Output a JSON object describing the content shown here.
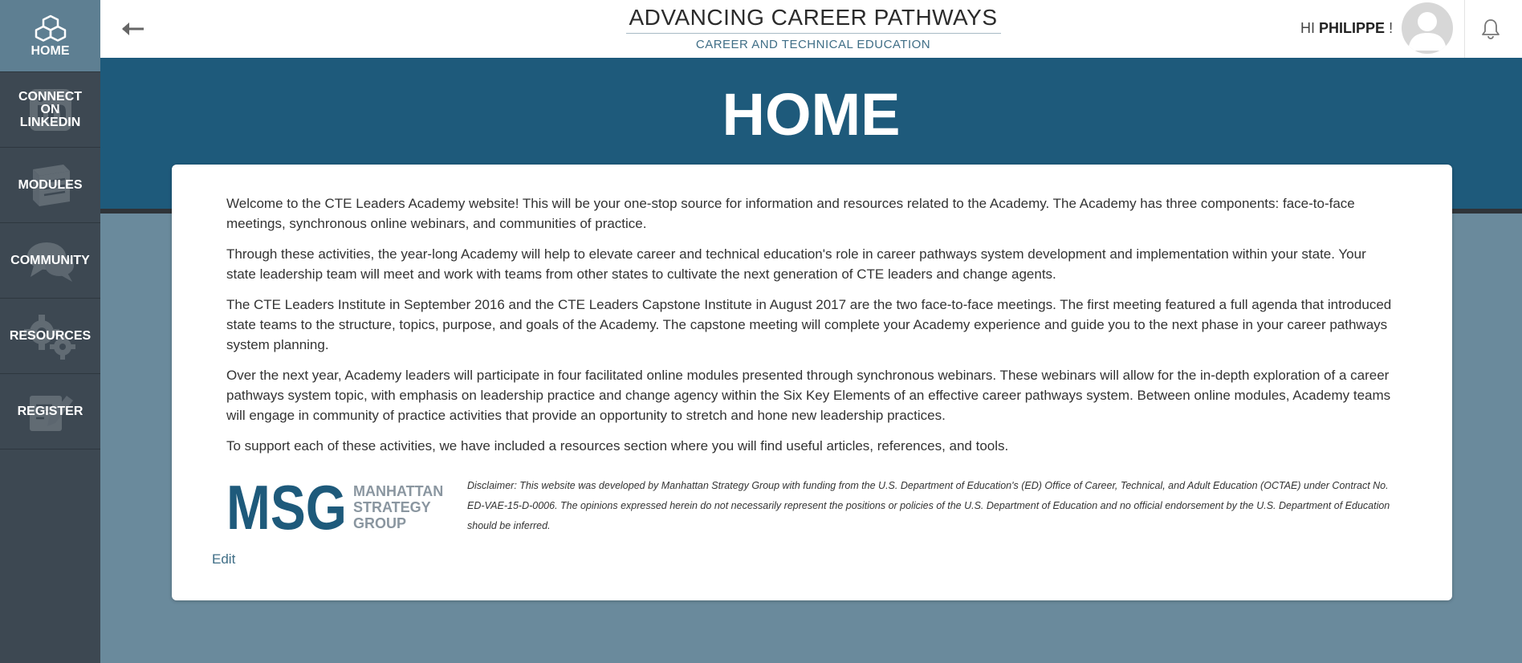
{
  "sidebar": {
    "items": [
      {
        "label": "HOME",
        "icon": "cubes-icon"
      },
      {
        "label": "CONNECT ON LINKEDIN",
        "icon": "linkedin-icon"
      },
      {
        "label": "MODULES",
        "icon": "book-icon"
      },
      {
        "label": "COMMUNITY",
        "icon": "chat-icon"
      },
      {
        "label": "RESOURCES",
        "icon": "gears-icon"
      },
      {
        "label": "REGISTER",
        "icon": "edit-icon"
      }
    ]
  },
  "header": {
    "title": "ADVANCING CAREER PATHWAYS",
    "subtitle": "CAREER AND TECHNICAL EDUCATION",
    "greeting_prefix": "HI",
    "user_name": "PHILIPPE",
    "greeting_suffix": "!"
  },
  "banner": {
    "title": "HOME"
  },
  "content": {
    "paragraphs": [
      "Welcome to the CTE Leaders Academy website! This will be your one-stop source for information and resources related to the Academy. The Academy has three components: face-to-face meetings, synchronous online webinars, and communities of practice.",
      "Through these activities, the year-long Academy will help to elevate career and technical education's role in career pathways system development and implementation within your state. Your state leadership team will meet and work with teams from other states to cultivate the next generation of CTE leaders and change agents.",
      "The CTE Leaders Institute in September 2016 and the CTE Leaders Capstone Institute in August 2017 are the two face-to-face meetings. The first meeting featured a full agenda that introduced state teams to the structure, topics, purpose, and goals of the Academy. The capstone meeting will complete your Academy experience and guide you to the next phase in your career pathways system planning.",
      "Over the next year, Academy leaders will participate in four facilitated online modules presented through synchronous webinars. These webinars will allow for the in-depth exploration of a career pathways system topic, with emphasis on leadership practice and change agency within the Six Key Elements of an effective career pathways system. Between online modules, Academy teams will engage in community of practice activities that provide an opportunity to stretch and hone new leadership practices.",
      "To support each of these activities, we have included a resources section where you will find useful articles, references, and tools."
    ],
    "logo": {
      "mark": "MSG",
      "line1": "MANHATTAN",
      "line2": "STRATEGY",
      "line3": "GROUP"
    },
    "disclaimer": "Disclaimer: This website was developed by Manhattan Strategy Group with funding from the U.S. Department of Education's (ED) Office of Career, Technical, and Adult Education (OCTAE) under Contract No. ED-VAE-15-D-0006. The opinions expressed herein do not necessarily represent the positions or policies of the U.S. Department of Education and no official endorsement by the U.S. Department of Education should be inferred.",
    "edit_label": "Edit"
  },
  "colors": {
    "sidebar": "#3d4852",
    "sidebar_active": "#5e7f92",
    "banner": "#1e5a7b",
    "page_bg": "#6a8a9c",
    "accent": "#3f6e86",
    "logo_blue": "#1e5a7b",
    "logo_gray": "#8a96a0"
  }
}
